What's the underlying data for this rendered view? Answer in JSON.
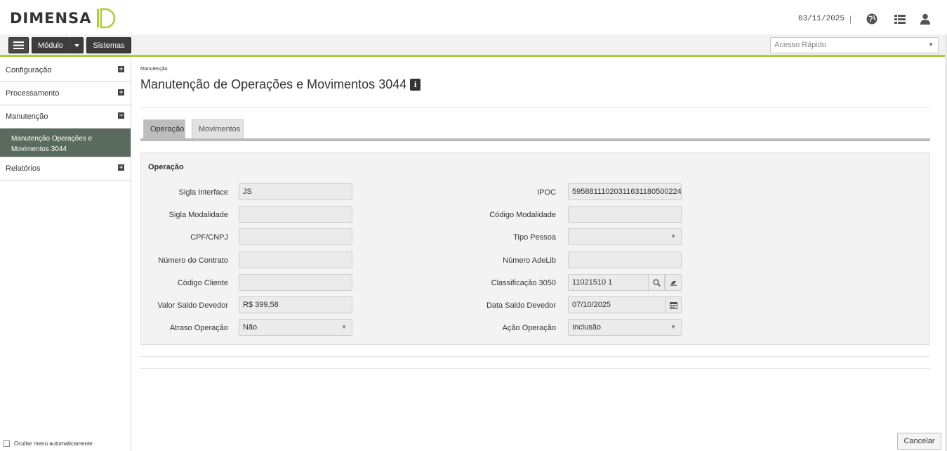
{
  "header": {
    "logo_text": "DIMENSA",
    "date": "03/11/2025",
    "separator": "|"
  },
  "toolbar": {
    "modulo_label": "Módulo",
    "sistemas_label": "Sistemas",
    "quick_access_placeholder": "Acesso Rápido"
  },
  "sidebar": {
    "items": [
      {
        "label": "Configuração",
        "toggle": "+"
      },
      {
        "label": "Processamento",
        "toggle": "+"
      },
      {
        "label": "Manutenção",
        "toggle": "−"
      },
      {
        "label": "Relatórios",
        "toggle": "+"
      }
    ],
    "active_sub": "Manutenção Operações e Movimentos 3044",
    "footer_label": "Ocultar menu automaticamente"
  },
  "page": {
    "breadcrumb": "Manutenção",
    "title": "Manutenção de Operações e Movimentos 3044",
    "info_icon": "i"
  },
  "tabs": [
    {
      "label": "Operação",
      "active": true
    },
    {
      "label": "Movimentos",
      "active": false
    }
  ],
  "form": {
    "section_title": "Operação",
    "left": [
      {
        "label": "Sigla Interface",
        "value": "JS"
      },
      {
        "label": "Sigla Modalidade",
        "value": ""
      },
      {
        "label": "CPF/CNPJ",
        "value": ""
      },
      {
        "label": "Número do Contrato",
        "value": ""
      },
      {
        "label": "Código Cliente",
        "value": ""
      },
      {
        "label": "Valor Saldo Devedor",
        "value": "R$ 399,58"
      },
      {
        "label": "Atraso Operação",
        "value": "Não"
      }
    ],
    "right": [
      {
        "label": "IPOC",
        "value": "59588111020311631180500224"
      },
      {
        "label": "Código Modalidade",
        "value": ""
      },
      {
        "label": "Tipo Pessoa",
        "value": ""
      },
      {
        "label": "Número AdeLib",
        "value": ""
      },
      {
        "label": "Classificação 3050",
        "value": "11021510 1"
      },
      {
        "label": "Data Saldo Devedor",
        "value": "07/10/2025"
      },
      {
        "label": "Ação Operação",
        "value": "Inclusão"
      }
    ]
  },
  "actions": {
    "cancel_label": "Cancelar"
  },
  "colors": {
    "accent": "#a8cf3a",
    "sidebar_active": "#5a6a5f",
    "dark_button": "#3c3c3c"
  }
}
